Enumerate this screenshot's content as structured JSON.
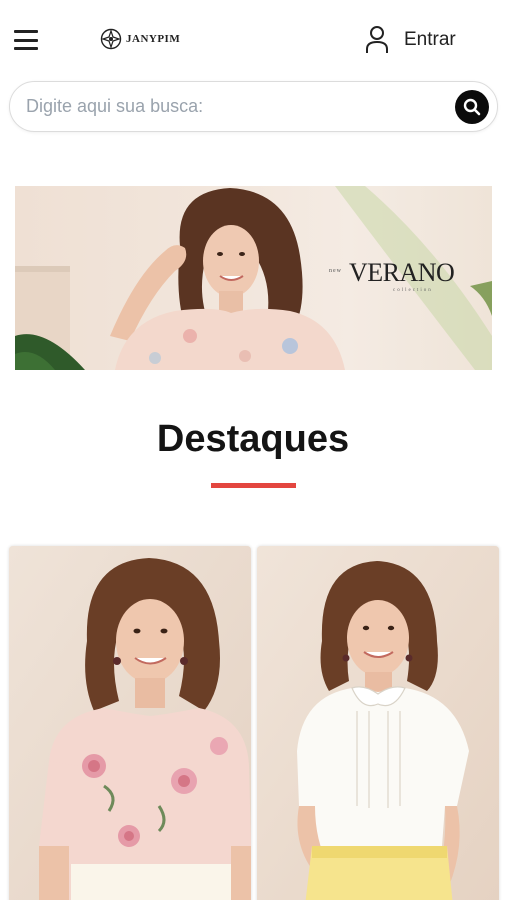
{
  "header": {
    "menu_icon": "hamburger-menu-icon",
    "brand": "JANYPIM",
    "login_icon": "user-icon",
    "login_label": "Entrar"
  },
  "search": {
    "placeholder": "Digite aqui sua busca:",
    "value": "",
    "button_icon": "search-icon"
  },
  "banner": {
    "prefix": "new",
    "title": "VERANO",
    "subtitle": "collection"
  },
  "featured": {
    "title": "Destaques",
    "accent_color": "#e3463f"
  },
  "products": [
    {
      "image": "model-floral-blouse"
    },
    {
      "image": "model-white-collar-blouse"
    }
  ]
}
